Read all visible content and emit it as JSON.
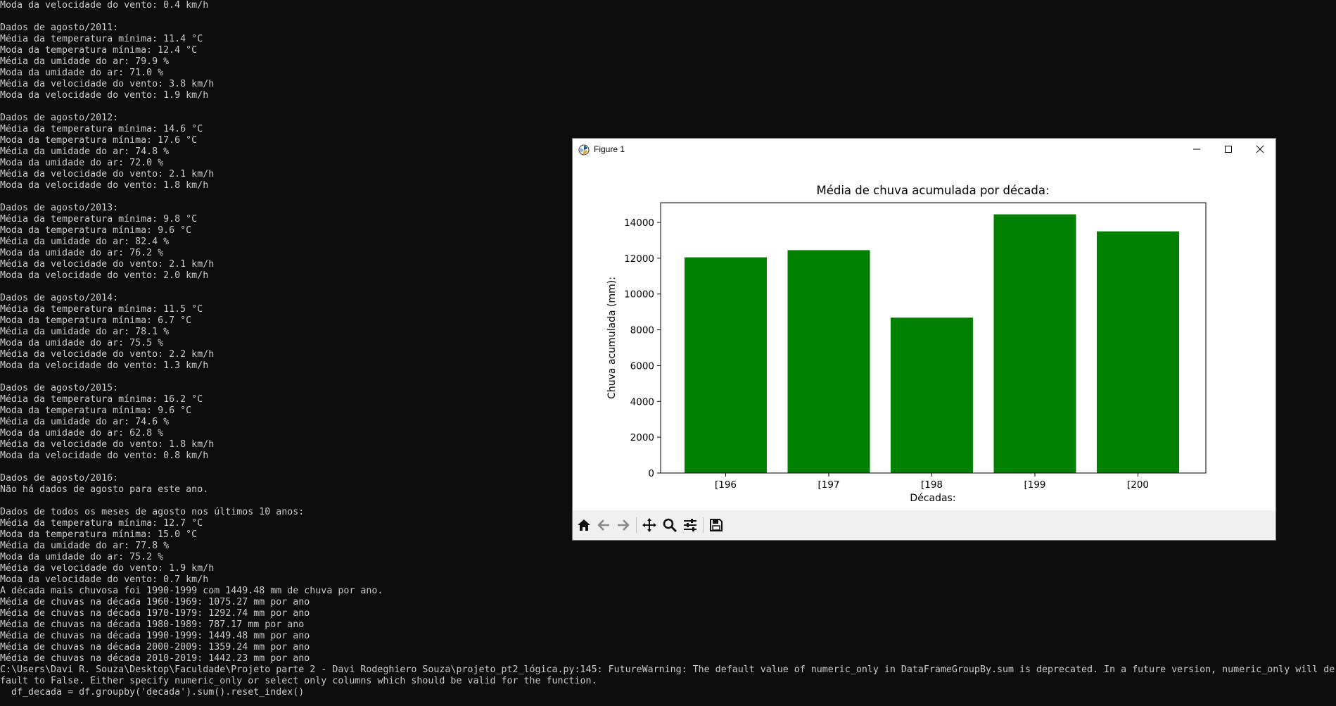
{
  "terminal": {
    "lines": [
      "Moda da velocidade do vento: 0.4 km/h",
      "",
      "Dados de agosto/2011:",
      "Média da temperatura mínima: 11.4 °C",
      "Moda da temperatura mínima: 12.4 °C",
      "Média da umidade do ar: 79.9 %",
      "Moda da umidade do ar: 71.0 %",
      "Média da velocidade do vento: 3.8 km/h",
      "Moda da velocidade do vento: 1.9 km/h",
      "",
      "Dados de agosto/2012:",
      "Média da temperatura mínima: 14.6 °C",
      "Moda da temperatura mínima: 17.6 °C",
      "Média da umidade do ar: 74.8 %",
      "Moda da umidade do ar: 72.0 %",
      "Média da velocidade do vento: 2.1 km/h",
      "Moda da velocidade do vento: 1.8 km/h",
      "",
      "Dados de agosto/2013:",
      "Média da temperatura mínima: 9.8 °C",
      "Moda da temperatura mínima: 9.6 °C",
      "Média da umidade do ar: 82.4 %",
      "Moda da umidade do ar: 76.2 %",
      "Média da velocidade do vento: 2.1 km/h",
      "Moda da velocidade do vento: 2.0 km/h",
      "",
      "Dados de agosto/2014:",
      "Média da temperatura mínima: 11.5 °C",
      "Moda da temperatura mínima: 6.7 °C",
      "Média da umidade do ar: 78.1 %",
      "Moda da umidade do ar: 75.5 %",
      "Média da velocidade do vento: 2.2 km/h",
      "Moda da velocidade do vento: 1.3 km/h",
      "",
      "Dados de agosto/2015:",
      "Média da temperatura mínima: 16.2 °C",
      "Moda da temperatura mínima: 9.6 °C",
      "Média da umidade do ar: 74.6 %",
      "Moda da umidade do ar: 62.8 %",
      "Média da velocidade do vento: 1.8 km/h",
      "Moda da velocidade do vento: 0.8 km/h",
      "",
      "Dados de agosto/2016:",
      "Não há dados de agosto para este ano.",
      "",
      "Dados de todos os meses de agosto nos últimos 10 anos:",
      "Média da temperatura mínima: 12.7 °C",
      "Moda da temperatura mínima: 15.0 °C",
      "Média da umidade do ar: 77.8 %",
      "Moda da umidade do ar: 75.2 %",
      "Média da velocidade do vento: 1.9 km/h",
      "Moda da velocidade do vento: 0.7 km/h",
      "A década mais chuvosa foi 1990-1999 com 1449.48 mm de chuva por ano.",
      "Média de chuvas na década 1960-1969: 1075.27 mm por ano",
      "Média de chuvas na década 1970-1979: 1292.74 mm por ano",
      "Média de chuvas na década 1980-1989: 787.17 mm por ano",
      "Média de chuvas na década 1990-1999: 1449.48 mm por ano",
      "Média de chuvas na década 2000-2009: 1359.24 mm por ano",
      "Média de chuvas na década 2010-2019: 1442.23 mm por ano",
      "C:\\Users\\Davi R. Souza\\Desktop\\Faculdade\\Projeto parte 2 - Davi Rodeghiero Souza\\projeto_pt2_lógica.py:145: FutureWarning: The default value of numeric_only in DataFrameGroupBy.sum is deprecated. In a future version, numeric_only will de",
      "fault to False. Either specify numeric_only or select only columns which should be valid for the function.",
      "  df_decada = df.groupby('decada').sum().reset_index()"
    ]
  },
  "window": {
    "title": "Figure 1",
    "icons": {
      "app": "matplotlib-icon",
      "minimize": "minimize-icon",
      "maximize": "maximize-icon",
      "close": "close-icon"
    }
  },
  "toolbar": {
    "buttons": [
      "home-icon",
      "back-arrow-icon",
      "forward-arrow-icon",
      "pan-icon",
      "zoom-icon",
      "configure-subplots-icon",
      "save-icon"
    ]
  },
  "chart_data": {
    "type": "bar",
    "title": "Média de chuva acumulada por década:",
    "xlabel": "Décadas:",
    "ylabel": "Chuva acumulada (mm):",
    "categories": [
      "[196",
      "[197",
      "[198",
      "[199",
      "[200"
    ],
    "values": [
      12050,
      12450,
      8680,
      14450,
      13500
    ],
    "ylim": [
      0,
      15100
    ],
    "yticks": [
      0,
      2000,
      4000,
      6000,
      8000,
      10000,
      12000,
      14000
    ],
    "bar_color": "#008000",
    "grid": false
  }
}
